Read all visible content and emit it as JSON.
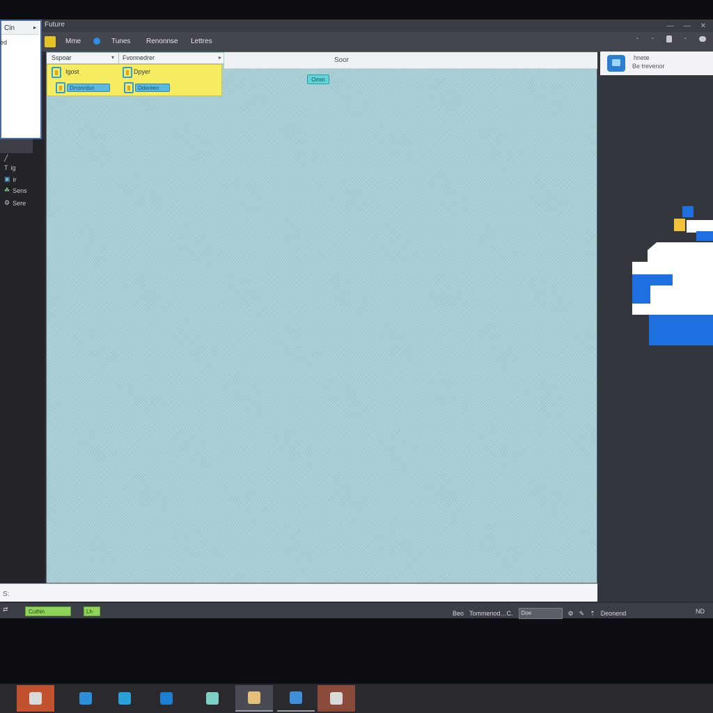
{
  "window": {
    "title": "Future",
    "controls": [
      "—",
      "—",
      "✕"
    ]
  },
  "menu": {
    "items": [
      "Mme",
      "Tunes",
      "Renonnse",
      "Lettres"
    ],
    "right_icons": [
      "-",
      "-",
      "lock-icon",
      "-",
      "cloud-icon"
    ]
  },
  "popup": {
    "title": "Cin",
    "caret": "▸",
    "item": "ed"
  },
  "sidebar": {
    "items": [
      {
        "icon": "╱",
        "label": ""
      },
      {
        "icon": "T",
        "label": "ig"
      },
      {
        "icon": "▣",
        "label": "ir"
      },
      {
        "icon": "☘",
        "label": "Sens"
      },
      {
        "icon": "⚙",
        "label": "Sere"
      }
    ]
  },
  "canvas": {
    "header_search": "Soor",
    "columns": [
      "Sspoar",
      "Fvonnedrer"
    ],
    "rows": [
      {
        "label": "Igost",
        "chip": "Drronrdsn"
      },
      {
        "label": "Dpyer",
        "chip": "Ddereen"
      }
    ],
    "tag": "Omm"
  },
  "notice": {
    "title": "hnete",
    "subtitle": "Be trevenor"
  },
  "input_strip": {
    "icon_text": "S:"
  },
  "status": {
    "green_label": "Cuthin",
    "green2_label": "Lh",
    "label1": "Beo",
    "label2": "Tommenod…C.",
    "field_value": "Doe",
    "icons": [
      "gear",
      "pin",
      "arrow"
    ],
    "right_label": "Deonend",
    "end_label": "ND"
  },
  "taskbar": {
    "apps": [
      {
        "name": "app-1",
        "color": "#c0522f"
      },
      {
        "name": "app-2",
        "color": "#2e8fd6"
      },
      {
        "name": "app-3",
        "color": "#2aa0d8"
      },
      {
        "name": "app-4",
        "color": "#1e7ed0"
      },
      {
        "name": "app-5",
        "color": "#7fd0c4"
      },
      {
        "name": "app-6",
        "color": "#e6c07a"
      },
      {
        "name": "app-7",
        "color": "#3f8fd8"
      },
      {
        "name": "app-8",
        "color": "#8a4a3a"
      }
    ]
  },
  "colors": {
    "accent_blue": "#1e6fe0",
    "selection_yellow": "#f6ec62",
    "canvas_bg": "#a7cfd6",
    "status_green": "#8fd35a"
  }
}
